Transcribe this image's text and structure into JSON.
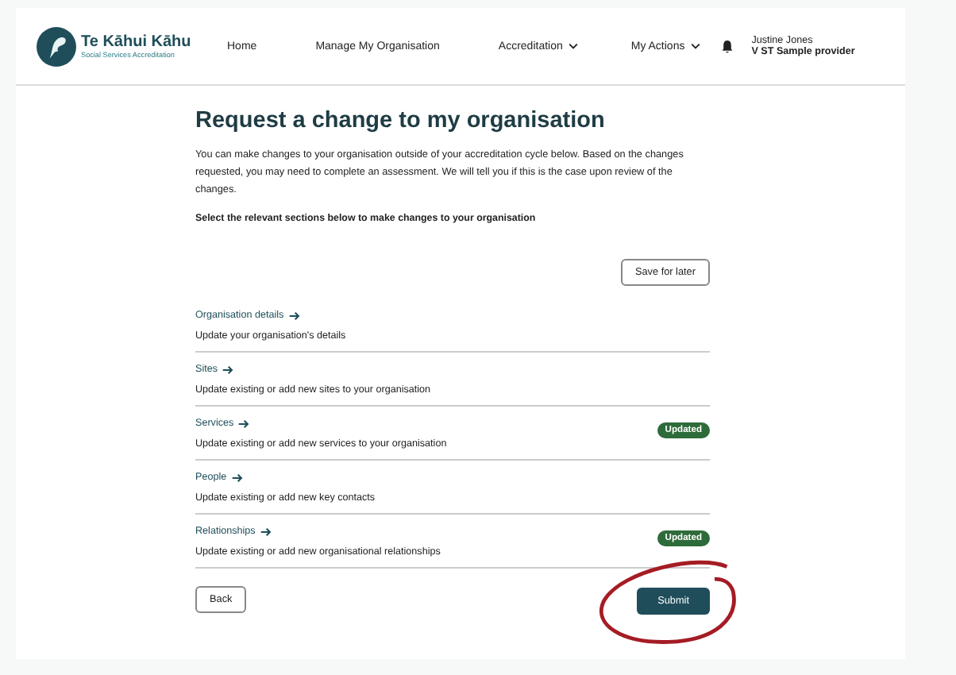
{
  "logo": {
    "name": "Te Kāhui Kāhu",
    "tagline": "Social Services Accreditation"
  },
  "nav": [
    {
      "label": "Home",
      "has_menu": false
    },
    {
      "label": "Manage My Organisation",
      "has_menu": false
    },
    {
      "label": "Accreditation",
      "has_menu": true
    },
    {
      "label": "My Actions",
      "has_menu": true
    }
  ],
  "user": {
    "name": "Justine Jones",
    "organisation": "V ST Sample provider"
  },
  "title": "Request a change to my organisation",
  "intro": "You can make changes to your organisation outside of your accreditation cycle below. Based on the changes requested, you may need to complete an assessment. We will tell you if this is the case upon review of the changes.",
  "instruction": "Select the relevant sections below to make changes to your organisation",
  "save_button": "Save for later",
  "sections": [
    {
      "title": "Organisation details",
      "description": "Update your organisation's details"
    },
    {
      "title": "Sites",
      "description": "Update existing or add new sites to your organisation"
    },
    {
      "title": "Services",
      "description": "Update existing or add new services to your organisation",
      "badge": "Updated"
    },
    {
      "title": "People",
      "description": "Update existing or add new key contacts"
    },
    {
      "title": "Relationships",
      "description": "Update existing or add new organisational relationships",
      "badge": "Updated"
    }
  ],
  "back_button": "Back",
  "submit_button": "Submit"
}
